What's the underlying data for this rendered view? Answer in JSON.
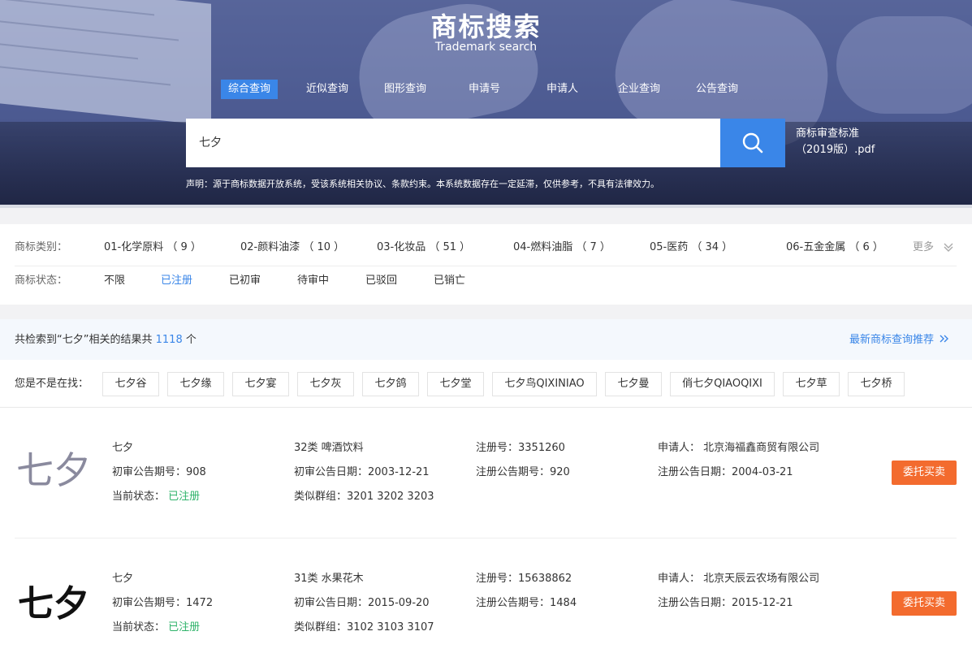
{
  "header": {
    "title": "商标搜索",
    "subtitle": "Trademark search",
    "tabs": [
      {
        "label": "综合查询",
        "active": true
      },
      {
        "label": "近似查询",
        "active": false
      },
      {
        "label": "图形查询",
        "active": false
      },
      {
        "label": "申请号",
        "active": false
      },
      {
        "label": "申请人",
        "active": false
      },
      {
        "label": "企业查询",
        "active": false
      },
      {
        "label": "公告查询",
        "active": false
      }
    ],
    "search": {
      "value": "七夕",
      "icon": "search-icon"
    },
    "pdf_link": {
      "line1": "商标审查标准",
      "line2": "（2019版）.pdf"
    },
    "disclaimer": "声明：源于商标数据开放系统，受该系统相关协议、条款约束。本系统数据存在一定延滞，仅供参考，不具有法律效力。"
  },
  "filters": {
    "category_label": "商标类别：",
    "categories": [
      "01-化学原料 （ 9 ）",
      "02-颜料油漆 （ 10 ）",
      "03-化妆品 （ 51 ）",
      "04-燃料油脂 （ 7 ）",
      "05-医药 （ 34 ）",
      "06-五金金属 （ 6 ）"
    ],
    "more_label": "更多",
    "status_label": "商标状态：",
    "statuses": [
      {
        "label": "不限",
        "selected": false
      },
      {
        "label": "已注册",
        "selected": true
      },
      {
        "label": "已初审",
        "selected": false
      },
      {
        "label": "待审中",
        "selected": false
      },
      {
        "label": "已驳回",
        "selected": false
      },
      {
        "label": "已销亡",
        "selected": false
      }
    ]
  },
  "summary": {
    "prefix": "共检索到“七夕”相关的结果共",
    "count": "1118",
    "suffix": "个",
    "recommend": "最新商标查询推荐"
  },
  "suggestions": {
    "label": "您是不是在找：",
    "items": [
      "七夕谷",
      "七夕缘",
      "七夕宴",
      "七夕灰",
      "七夕鸽",
      "七夕堂",
      "七夕鸟QIXINIAO",
      "七夕曼",
      "俏七夕QIAOQIXI",
      "七夕草",
      "七夕桥"
    ]
  },
  "results": [
    {
      "logo_text": "七夕",
      "name": "七夕",
      "prelim_no": "初审公告期号：908",
      "status_label": "当前状态：",
      "status_value": "已注册",
      "category": "32类 啤酒饮料",
      "prelim_date": "初审公告日期：2003-12-21",
      "similar_groups": "类似群组：3201 3202 3203",
      "reg_no": "注册号：3351260",
      "reg_notice_no": "注册公告期号：920",
      "applicant": "申请人：  北京海福鑫商贸有限公司",
      "reg_notice_date": "注册公告日期：2004-03-21",
      "button": "委托买卖"
    },
    {
      "logo_text": "七夕",
      "name": "七夕",
      "prelim_no": "初审公告期号：1472",
      "status_label": "当前状态：",
      "status_value": "已注册",
      "category": "31类 水果花木",
      "prelim_date": "初审公告日期：2015-09-20",
      "similar_groups": "类似群组：3102 3103 3107",
      "reg_no": "注册号：15638862",
      "reg_notice_no": "注册公告期号：1484",
      "applicant": "申请人：  北京天辰云农场有限公司",
      "reg_notice_date": "注册公告日期：2015-12-21",
      "button": "委托买卖"
    }
  ],
  "colors": {
    "accent": "#3a86e8",
    "action": "#f36b2e",
    "status_ok": "#2fb36a"
  }
}
